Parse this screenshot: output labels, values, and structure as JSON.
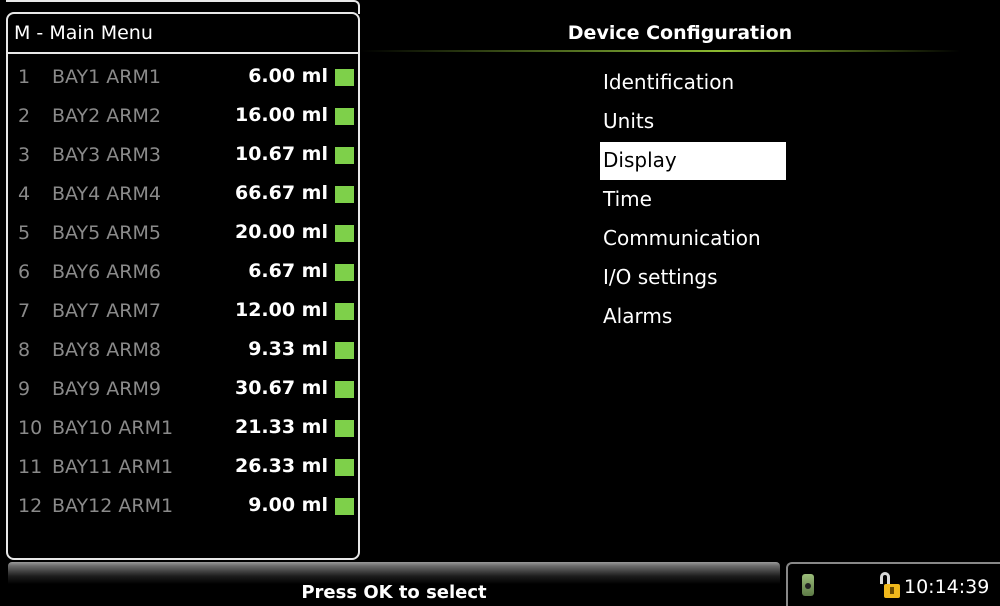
{
  "left_panel": {
    "title": "M - Main Menu",
    "rows": [
      {
        "num": "1",
        "name": "BAY1 ARM1",
        "value": "6.00 ml"
      },
      {
        "num": "2",
        "name": "BAY2 ARM2",
        "value": "16.00 ml"
      },
      {
        "num": "3",
        "name": "BAY3 ARM3",
        "value": "10.67 ml"
      },
      {
        "num": "4",
        "name": "BAY4 ARM4",
        "value": "66.67 ml"
      },
      {
        "num": "5",
        "name": "BAY5 ARM5",
        "value": "20.00 ml"
      },
      {
        "num": "6",
        "name": "BAY6 ARM6",
        "value": "6.67 ml"
      },
      {
        "num": "7",
        "name": "BAY7 ARM7",
        "value": "12.00 ml"
      },
      {
        "num": "8",
        "name": "BAY8 ARM8",
        "value": "9.33 ml"
      },
      {
        "num": "9",
        "name": "BAY9 ARM9",
        "value": "30.67 ml"
      },
      {
        "num": "10",
        "name": "BAY10 ARM1",
        "value": "21.33 ml"
      },
      {
        "num": "11",
        "name": "BAY11 ARM1",
        "value": "26.33 ml"
      },
      {
        "num": "12",
        "name": "BAY12 ARM1",
        "value": "9.00 ml"
      }
    ],
    "indicator_color": "#7ed04a"
  },
  "right_panel": {
    "title": "Device Configuration",
    "menu": [
      {
        "label": "Identification",
        "selected": false
      },
      {
        "label": "Units",
        "selected": false
      },
      {
        "label": "Display",
        "selected": true
      },
      {
        "label": "Time",
        "selected": false
      },
      {
        "label": "Communication",
        "selected": false
      },
      {
        "label": "I/O settings",
        "selected": false
      },
      {
        "label": "Alarms",
        "selected": false
      }
    ]
  },
  "status_bar": {
    "hint": "Press OK to select",
    "device_icon": "handheld-device-icon",
    "lock_icon": "unlocked-padlock-icon",
    "time": "10:14:39"
  }
}
